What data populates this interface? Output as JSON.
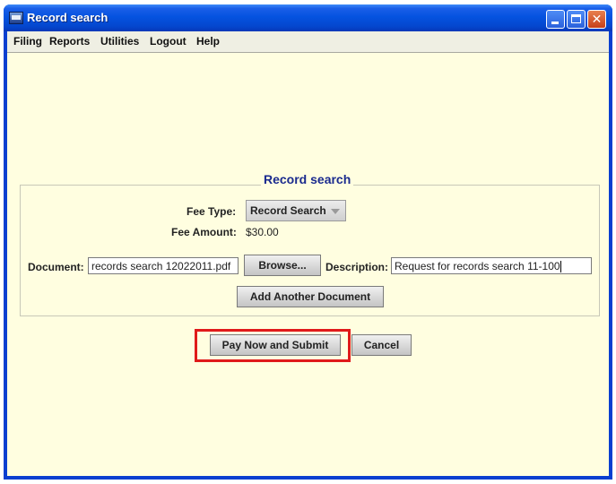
{
  "window": {
    "title": "Record search",
    "minimize": "minimize",
    "maximize": "maximize",
    "close": "close"
  },
  "menu": [
    "Filing",
    "Reports",
    "Utilities",
    "Logout",
    "Help"
  ],
  "group": {
    "title": "Record search",
    "fee_type_label": "Fee Type:",
    "fee_type_value": "Record Search",
    "fee_amount_label": "Fee Amount:",
    "fee_amount_value": "$30.00",
    "document_label": "Document:",
    "document_value": "records search 12022011.pdf",
    "browse_label": "Browse...",
    "description_label": "Description:",
    "description_value": "Request for records search 11-100",
    "add_document_label": "Add Another Document"
  },
  "actions": {
    "pay_label": "Pay Now and Submit",
    "cancel_label": "Cancel"
  },
  "colors": {
    "title_bar": "#0553e0",
    "client_bg": "#fffee0",
    "group_title": "#1a2a8e",
    "highlight": "#e01a1a"
  }
}
